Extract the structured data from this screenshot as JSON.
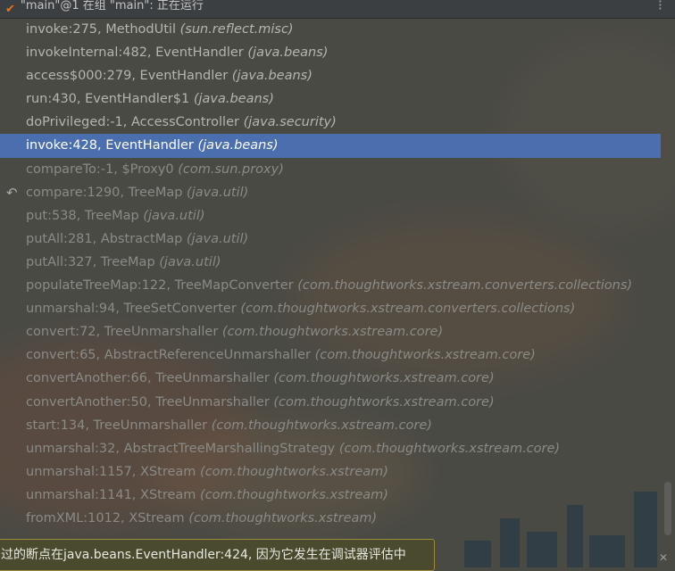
{
  "titlebar": {
    "title": "\"main\"@1 在组 \"main\": 正在运行",
    "check_icon": "check-icon",
    "more_icon": "more-icon"
  },
  "frames": [
    {
      "method": "invoke:275, MethodUtil",
      "pkg": "(sun.reflect.misc)",
      "state": "normal"
    },
    {
      "method": "invokeInternal:482, EventHandler",
      "pkg": "(java.beans)",
      "state": "normal"
    },
    {
      "method": "access$000:279, EventHandler",
      "pkg": "(java.beans)",
      "state": "normal"
    },
    {
      "method": "run:430, EventHandler$1",
      "pkg": "(java.beans)",
      "state": "normal"
    },
    {
      "method": "doPrivileged:-1, AccessController",
      "pkg": "(java.security)",
      "state": "normal"
    },
    {
      "method": "invoke:428, EventHandler",
      "pkg": "(java.beans)",
      "state": "selected"
    },
    {
      "method": "compareTo:-1, $Proxy0",
      "pkg": "(com.sun.proxy)",
      "state": "dim"
    },
    {
      "method": "compare:1290, TreeMap",
      "pkg": "(java.util)",
      "state": "dim",
      "icon": "return-arrow-icon"
    },
    {
      "method": "put:538, TreeMap",
      "pkg": "(java.util)",
      "state": "dim"
    },
    {
      "method": "putAll:281, AbstractMap",
      "pkg": "(java.util)",
      "state": "dim"
    },
    {
      "method": "putAll:327, TreeMap",
      "pkg": "(java.util)",
      "state": "dim"
    },
    {
      "method": "populateTreeMap:122, TreeMapConverter",
      "pkg": "(com.thoughtworks.xstream.converters.collections)",
      "state": "dim"
    },
    {
      "method": "unmarshal:94, TreeSetConverter",
      "pkg": "(com.thoughtworks.xstream.converters.collections)",
      "state": "dim"
    },
    {
      "method": "convert:72, TreeUnmarshaller",
      "pkg": "(com.thoughtworks.xstream.core)",
      "state": "dim"
    },
    {
      "method": "convert:65, AbstractReferenceUnmarshaller",
      "pkg": "(com.thoughtworks.xstream.core)",
      "state": "dim"
    },
    {
      "method": "convertAnother:66, TreeUnmarshaller",
      "pkg": "(com.thoughtworks.xstream.core)",
      "state": "dim"
    },
    {
      "method": "convertAnother:50, TreeUnmarshaller",
      "pkg": "(com.thoughtworks.xstream.core)",
      "state": "dim"
    },
    {
      "method": "start:134, TreeUnmarshaller",
      "pkg": "(com.thoughtworks.xstream.core)",
      "state": "dim"
    },
    {
      "method": "unmarshal:32, AbstractTreeMarshallingStrategy",
      "pkg": "(com.thoughtworks.xstream.core)",
      "state": "dim"
    },
    {
      "method": "unmarshal:1157, XStream",
      "pkg": "(com.thoughtworks.xstream)",
      "state": "dim"
    },
    {
      "method": "unmarshal:1141, XStream",
      "pkg": "(com.thoughtworks.xstream)",
      "state": "dim"
    },
    {
      "method": "fromXML:1012, XStream",
      "pkg": "(com.thoughtworks.xstream)",
      "state": "dim"
    }
  ],
  "notice": {
    "text": "过的断点在java.beans.EventHandler:424, 因为它发生在调试器评估中"
  },
  "colors": {
    "selection": "#4b6eaf",
    "notice_border": "#9a8a3a"
  }
}
